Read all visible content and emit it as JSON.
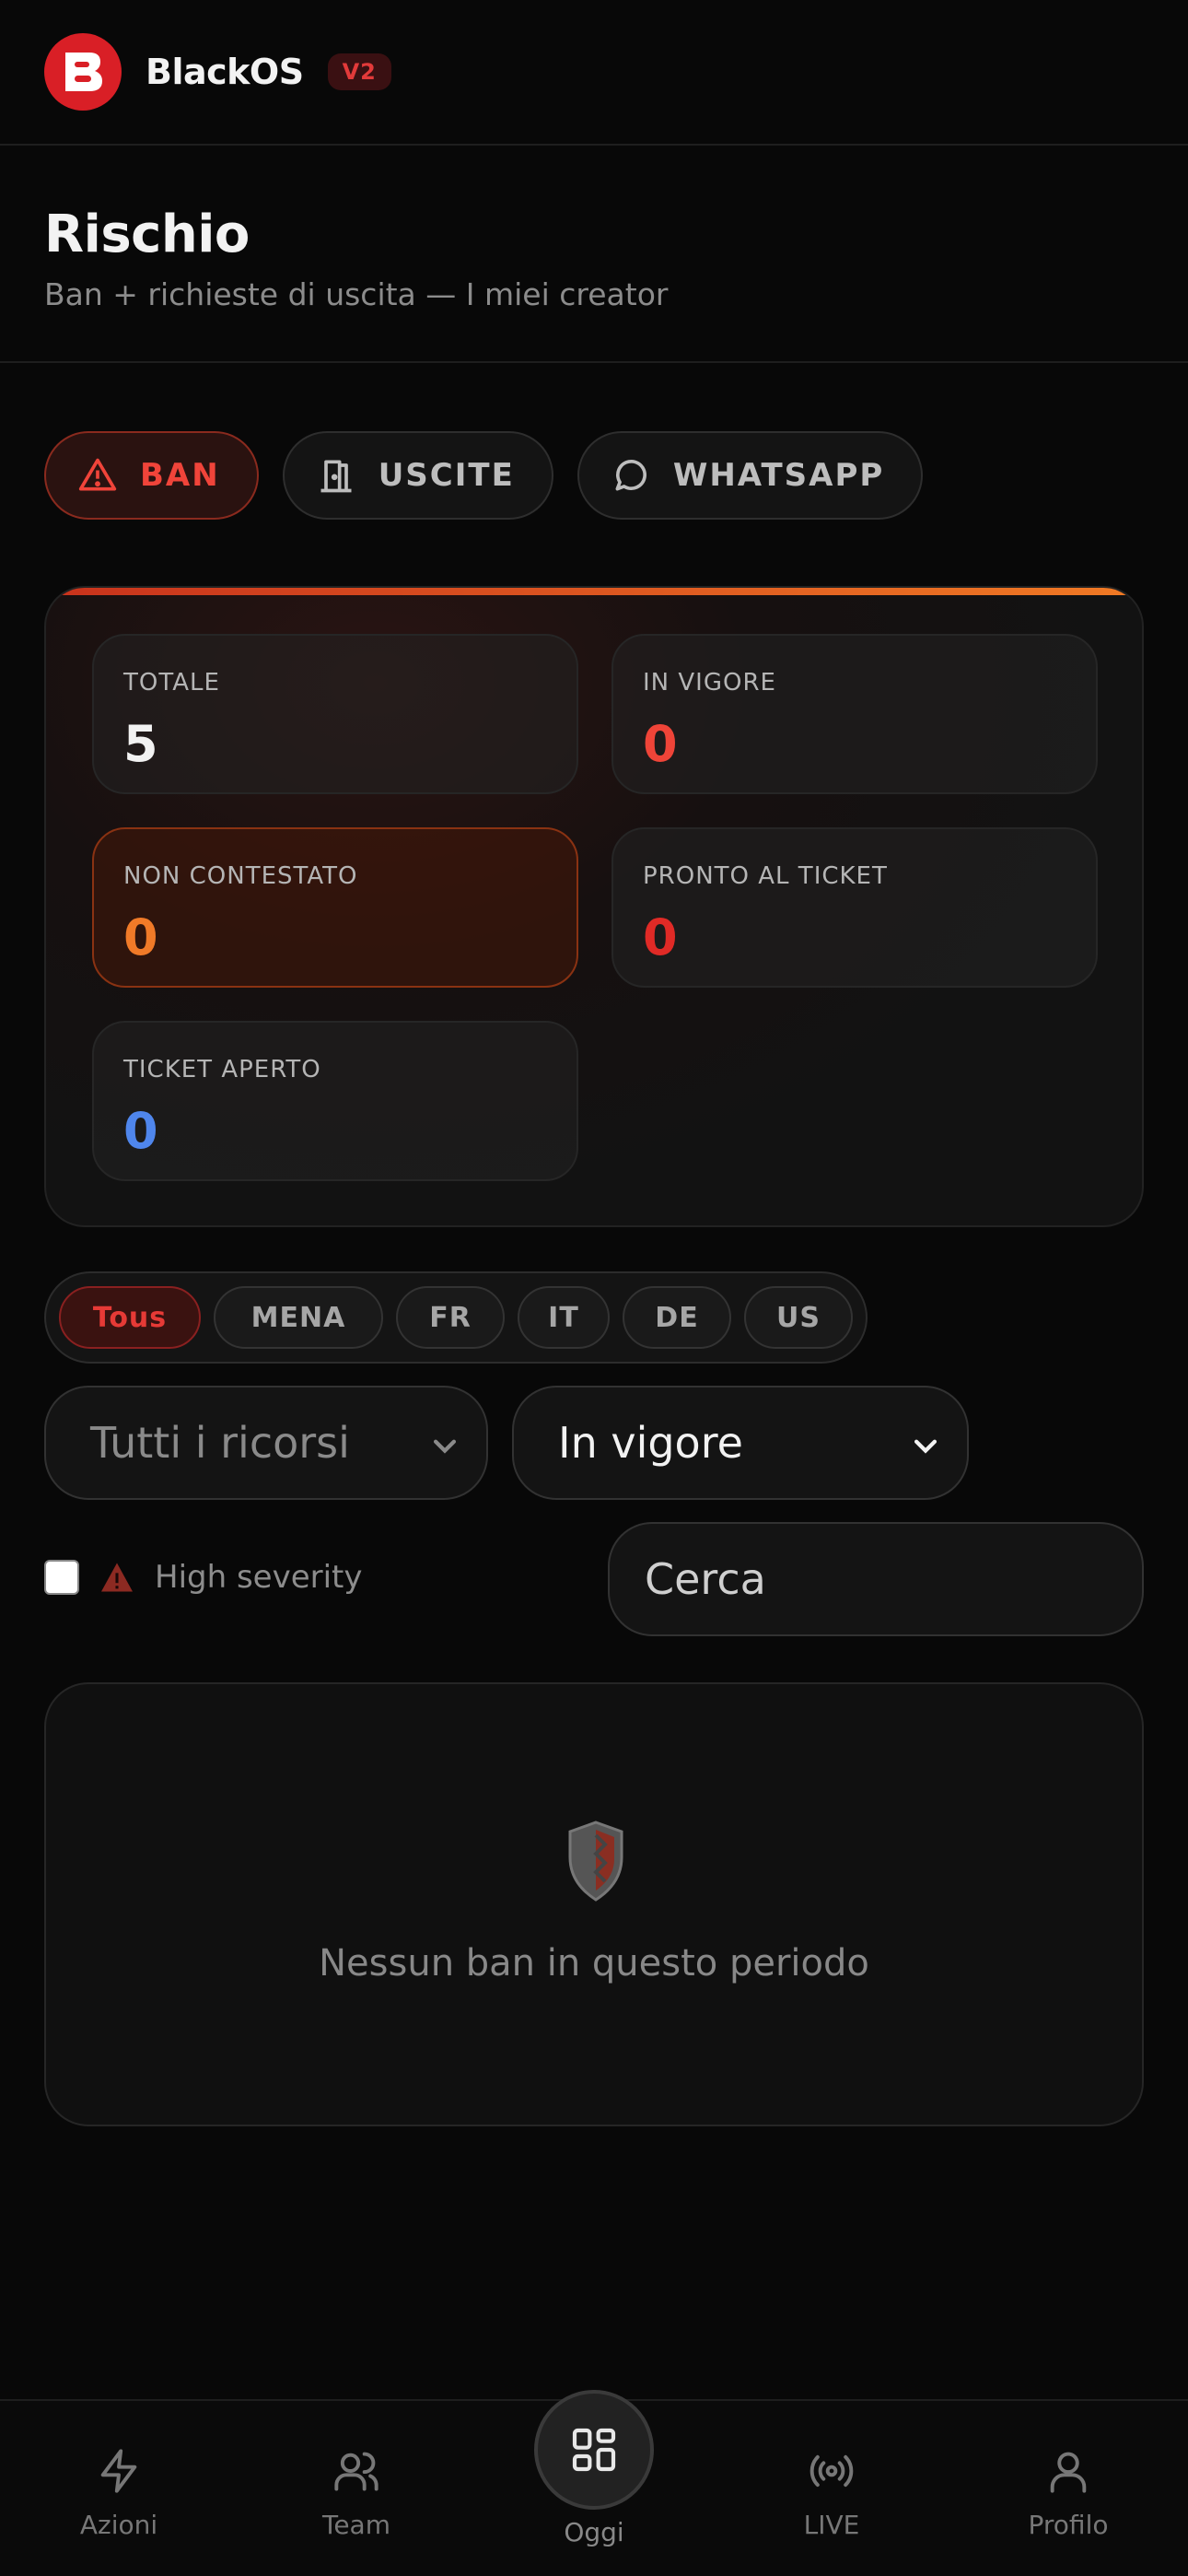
{
  "header": {
    "brand": "BlackOS",
    "version": "V2"
  },
  "page": {
    "title": "Rischio",
    "subtitle": "Ban + richieste di uscita — I miei creator"
  },
  "tabs": [
    {
      "label": "BAN",
      "icon": "warning-icon",
      "active": true
    },
    {
      "label": "USCITE",
      "icon": "door-icon",
      "active": false
    },
    {
      "label": "WHATSAPP",
      "icon": "chat-bubble-icon",
      "active": false
    }
  ],
  "stats": [
    {
      "label": "TOTALE",
      "value": "5",
      "color": "#f2f2f2"
    },
    {
      "label": "IN VIGORE",
      "value": "0",
      "color": "#ef4438"
    },
    {
      "label": "NON CONTESTATO",
      "value": "0",
      "color": "#f07a28"
    },
    {
      "label": "PRONTO AL TICKET",
      "value": "0",
      "color": "#e02a26"
    },
    {
      "label": "TICKET APERTO",
      "value": "0",
      "color": "#4f86ec"
    }
  ],
  "regions": [
    {
      "label": "Tous",
      "active": true
    },
    {
      "label": "MENA",
      "active": false
    },
    {
      "label": "FR",
      "active": false
    },
    {
      "label": "IT",
      "active": false
    },
    {
      "label": "DE",
      "active": false
    },
    {
      "label": "US",
      "active": false
    }
  ],
  "filters": {
    "appeals_select": "Tutti i ricorsi",
    "status_select": "In vigore",
    "high_severity_label": "High severity",
    "search_placeholder": "Cerca"
  },
  "empty_state": {
    "message": "Nessun ban in questo periodo"
  },
  "nav": {
    "items": [
      {
        "label": "Azioni",
        "icon": "lightning-icon"
      },
      {
        "label": "Team",
        "icon": "users-icon"
      },
      {
        "label": "Oggi",
        "icon": "grid-icon"
      },
      {
        "label": "LIVE",
        "icon": "broadcast-icon"
      },
      {
        "label": "Profilo",
        "icon": "user-icon"
      }
    ]
  },
  "colors": {
    "accent": "#d91f26",
    "background": "#080808"
  }
}
